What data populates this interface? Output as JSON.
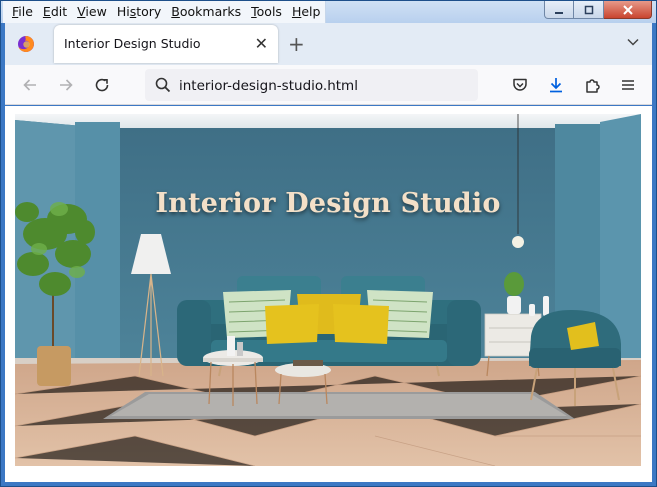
{
  "menu": {
    "items": [
      {
        "u": "F",
        "rest": "ile"
      },
      {
        "u": "E",
        "rest": "dit"
      },
      {
        "u": "V",
        "rest": "iew"
      },
      {
        "u": "H",
        "rest": "istory",
        "prefix": "Hi",
        "u2": "s",
        "rest2": "tory"
      },
      {
        "u": "B",
        "rest": "ookmarks"
      },
      {
        "u": "T",
        "rest": "ools"
      },
      {
        "u": "H",
        "rest": "elp"
      }
    ]
  },
  "tab": {
    "title": "Interior Design Studio",
    "close": "✕"
  },
  "newtab": "+",
  "url": "interior-design-studio.html",
  "hero": {
    "title": "Interior Design Studio"
  },
  "colors": {
    "accent": "#0060df",
    "wall": "#4b849c",
    "sofa": "#2f6f7e",
    "pillow": "#e5c21e"
  }
}
